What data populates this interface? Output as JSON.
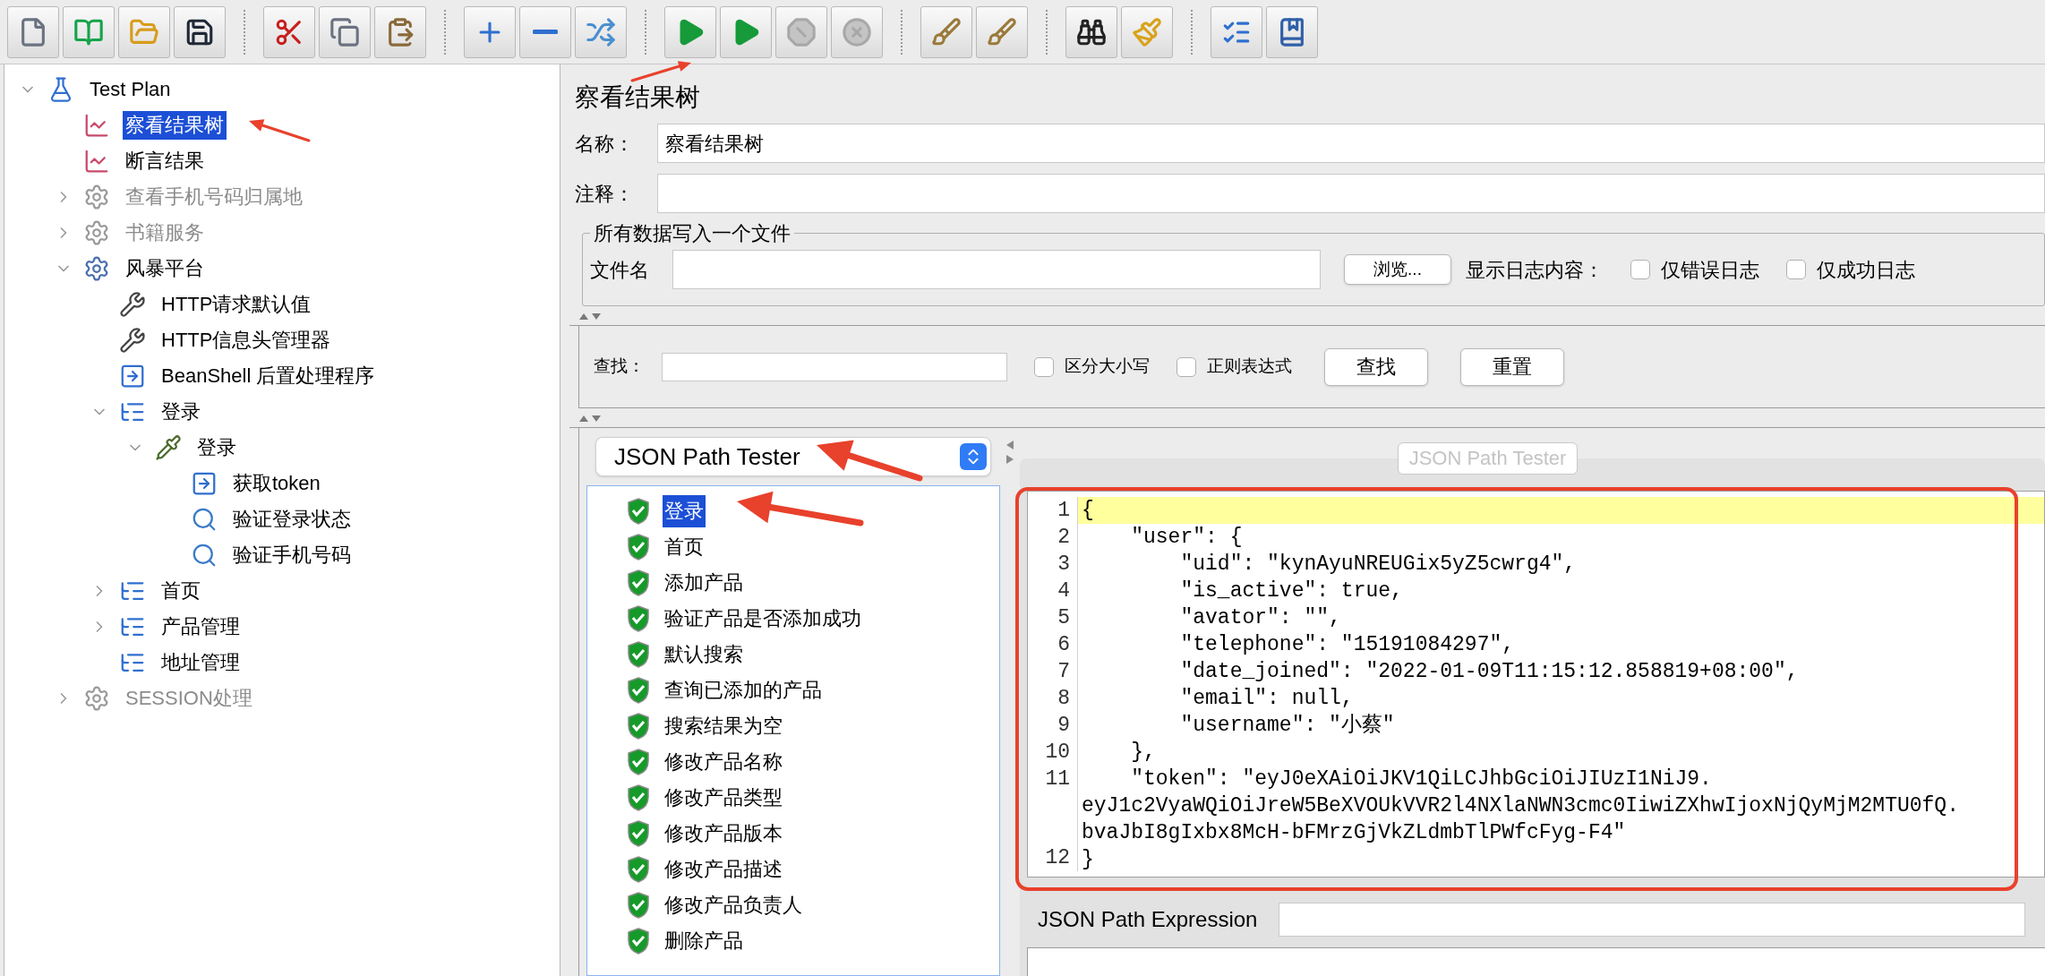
{
  "toolbar": [
    [
      {
        "kind": "new",
        "disabled": false
      },
      {
        "kind": "templates",
        "disabled": false
      },
      {
        "kind": "open",
        "disabled": false
      },
      {
        "kind": "save",
        "disabled": false
      }
    ],
    [
      {
        "kind": "cut",
        "disabled": false
      },
      {
        "kind": "copy",
        "disabled": false
      },
      {
        "kind": "paste",
        "disabled": false
      }
    ],
    [
      {
        "kind": "expand",
        "disabled": false
      },
      {
        "kind": "collapse",
        "disabled": false
      },
      {
        "kind": "toggle",
        "disabled": false
      }
    ],
    [
      {
        "kind": "start",
        "disabled": false
      },
      {
        "kind": "start-no-pause",
        "disabled": false
      },
      {
        "kind": "stop",
        "disabled": true
      },
      {
        "kind": "shutdown",
        "disabled": true
      }
    ],
    [
      {
        "kind": "clear",
        "disabled": false
      },
      {
        "kind": "clear-all",
        "disabled": false
      }
    ],
    [
      {
        "kind": "search",
        "disabled": false
      },
      {
        "kind": "reset-search",
        "disabled": false
      }
    ],
    [
      {
        "kind": "function-helper",
        "disabled": false
      },
      {
        "kind": "help",
        "disabled": false
      }
    ]
  ],
  "tree": [
    {
      "label": "Test Plan",
      "kind": "testplan",
      "expanded": true,
      "selected": false,
      "disabled": false,
      "children": [
        {
          "label": "察看结果树",
          "kind": "listener",
          "selected": true,
          "disabled": false
        },
        {
          "label": "断言结果",
          "kind": "listener",
          "selected": false,
          "disabled": false
        },
        {
          "label": "查看手机号码归属地",
          "kind": "threadgroup",
          "expanded": false,
          "selected": false,
          "disabled": true
        },
        {
          "label": "书籍服务",
          "kind": "threadgroup",
          "expanded": false,
          "selected": false,
          "disabled": true
        },
        {
          "label": "风暴平台",
          "kind": "threadgroup",
          "expanded": true,
          "selected": false,
          "disabled": false,
          "children": [
            {
              "label": "HTTP请求默认值",
              "kind": "config",
              "selected": false,
              "disabled": false
            },
            {
              "label": "HTTP信息头管理器",
              "kind": "config",
              "selected": false,
              "disabled": false
            },
            {
              "label": "BeanShell 后置处理程序",
              "kind": "postprocessor",
              "selected": false,
              "disabled": false
            },
            {
              "label": "登录",
              "kind": "controller",
              "expanded": true,
              "selected": false,
              "disabled": false,
              "children": [
                {
                  "label": "登录",
                  "kind": "sampler",
                  "expanded": true,
                  "selected": false,
                  "disabled": false,
                  "children": [
                    {
                      "label": "获取token",
                      "kind": "postprocessor",
                      "selected": false,
                      "disabled": false
                    },
                    {
                      "label": "验证登录状态",
                      "kind": "assertion",
                      "selected": false,
                      "disabled": false
                    },
                    {
                      "label": "验证手机号码",
                      "kind": "assertion",
                      "selected": false,
                      "disabled": false
                    }
                  ]
                }
              ]
            },
            {
              "label": "首页",
              "kind": "controller",
              "expanded": false,
              "selected": false,
              "disabled": false
            },
            {
              "label": "产品管理",
              "kind": "controller",
              "expanded": false,
              "selected": false,
              "disabled": false
            },
            {
              "label": "地址管理",
              "kind": "controller",
              "selected": false,
              "disabled": false
            }
          ]
        },
        {
          "label": "SESSION处理",
          "kind": "threadgroup",
          "expanded": false,
          "selected": false,
          "disabled": true
        }
      ]
    }
  ],
  "panel": {
    "title": "察看结果树",
    "name_label": "名称：",
    "name_value": "察看结果树",
    "comment_label": "注释：",
    "file_group": {
      "title": "所有数据写入一个文件",
      "filename_label": "文件名",
      "browse": "浏览...",
      "log_label": "显示日志内容：",
      "options": [
        {
          "label": "仅错误日志",
          "checked": false
        },
        {
          "label": "仅成功日志",
          "checked": false
        }
      ]
    },
    "search": {
      "label": "查找：",
      "options": [
        {
          "label": "区分大小写",
          "checked": false
        },
        {
          "label": "正则表达式",
          "checked": false
        }
      ],
      "buttons": [
        "查找",
        "重置"
      ]
    },
    "renderer": "JSON Path Tester",
    "results": [
      {
        "label": "登录",
        "selected": true
      },
      {
        "label": "首页",
        "selected": false
      },
      {
        "label": "添加产品",
        "selected": false
      },
      {
        "label": "验证产品是否添加成功",
        "selected": false
      },
      {
        "label": "默认搜索",
        "selected": false
      },
      {
        "label": "查询已添加的产品",
        "selected": false
      },
      {
        "label": "搜索结果为空",
        "selected": false
      },
      {
        "label": "修改产品名称",
        "selected": false
      },
      {
        "label": "修改产品类型",
        "selected": false
      },
      {
        "label": "修改产品版本",
        "selected": false
      },
      {
        "label": "修改产品描述",
        "selected": false
      },
      {
        "label": "修改产品负责人",
        "selected": false
      },
      {
        "label": "删除产品",
        "selected": false
      }
    ],
    "tab": "JSON Path Tester",
    "code_lines": [
      {
        "number": "1",
        "parts": [
          "{"
        ],
        "current": true
      },
      {
        "number": "2",
        "parts": [
          "    \"user\": {"
        ],
        "current": false
      },
      {
        "number": "3",
        "parts": [
          "        \"uid\": \"kynAyuNREUGix5yZ5cwrg4\","
        ],
        "current": false
      },
      {
        "number": "4",
        "parts": [
          "        \"is_active\": true,"
        ],
        "current": false
      },
      {
        "number": "5",
        "parts": [
          "        \"avator\": \"\","
        ],
        "current": false
      },
      {
        "number": "6",
        "parts": [
          "        \"telephone\": \"15191084297\","
        ],
        "current": false
      },
      {
        "number": "7",
        "parts": [
          "        \"date_joined\": \"2022-01-09T11:15:12.858819+08:00\","
        ],
        "current": false
      },
      {
        "number": "8",
        "parts": [
          "        \"email\": null,"
        ],
        "current": false
      },
      {
        "number": "9",
        "parts": [
          "        \"username\": \"小蔡\""
        ],
        "current": false
      },
      {
        "number": "10",
        "parts": [
          "    },"
        ],
        "current": false
      },
      {
        "number": "11",
        "parts": [
          "    \"token\": \"eyJ0eXAiOiJKV1QiLCJhbGciOiJIUzI1NiJ9.",
          "eyJ1c2VyaWQiOiJreW5BeXVOUkVVR2l4NXlaNWN3cmc0IiwiZXhwIjoxNjQyMjM2MTU0fQ.",
          "bvaJbI8gIxbx8McH-bFMrzGjVkZLdmbTlPWfcFyg-F4\""
        ],
        "current": false
      },
      {
        "number": "12",
        "parts": [
          "}"
        ],
        "current": false
      }
    ],
    "expression_label": "JSON Path Expression"
  }
}
